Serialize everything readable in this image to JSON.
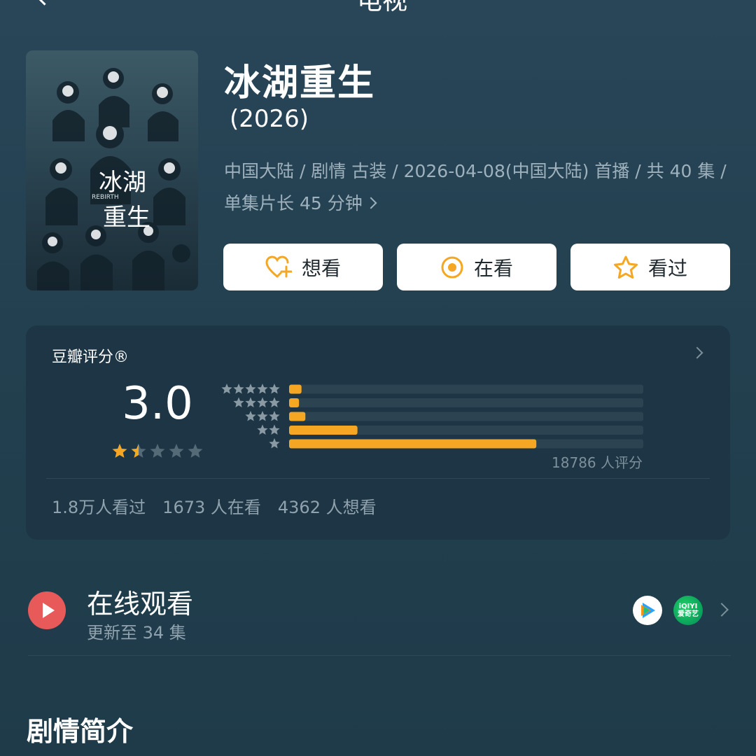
{
  "nav": {
    "title": "电视"
  },
  "movie": {
    "title": "冰湖重生",
    "year": "(2026)",
    "meta": "中国大陆 / 剧情 古装 / 2026-04-08(中国大陆) 首播 / 共 40 集 / 单集片长 45 分钟",
    "poster": {
      "title_art": "冰湖重生",
      "subtitle_art": "REBIRTH"
    }
  },
  "actions": {
    "want": "想看",
    "watching": "在看",
    "watched": "看过"
  },
  "rating": {
    "label": "豆瓣评分®",
    "score": "3.0",
    "stars_filled": 1.5,
    "stars_total": 5,
    "count_text": "18786 人评分",
    "distribution": [
      {
        "stars": 5,
        "percent": 3.5
      },
      {
        "stars": 4,
        "percent": 2.8
      },
      {
        "stars": 3,
        "percent": 4.6
      },
      {
        "stars": 2,
        "percent": 19.3
      },
      {
        "stars": 1,
        "percent": 69.8
      }
    ],
    "stats": {
      "watched": "1.8万人看过",
      "watching": "1673 人在看",
      "want": "4362 人想看"
    }
  },
  "watch": {
    "title": "在线观看",
    "subtitle": "更新至 34 集",
    "providers": [
      "tencent-video",
      "iqiyi"
    ],
    "iqiyi_top": "iQIYI",
    "iqiyi_bottom": "爱奇艺"
  },
  "section": {
    "title": "剧情简介"
  },
  "colors": {
    "accent": "#f5a623",
    "track": "#2c4451",
    "play": "#e85a5a",
    "star_empty": "#556a77"
  }
}
